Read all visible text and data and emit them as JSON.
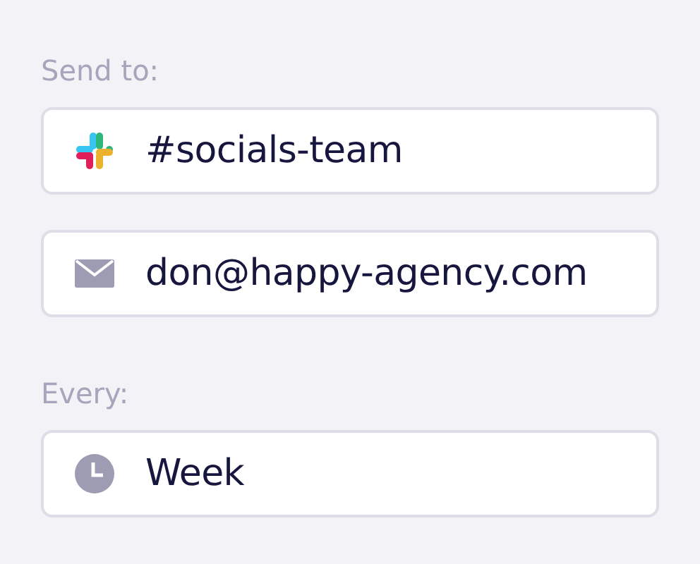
{
  "sections": [
    {
      "label": "Send to:",
      "fields": [
        {
          "kind": "slack",
          "value": "#socials-team"
        },
        {
          "kind": "email",
          "value": "don@happy-agency.com"
        }
      ]
    },
    {
      "label": "Every:",
      "fields": [
        {
          "kind": "clock",
          "value": "Week"
        }
      ]
    }
  ]
}
